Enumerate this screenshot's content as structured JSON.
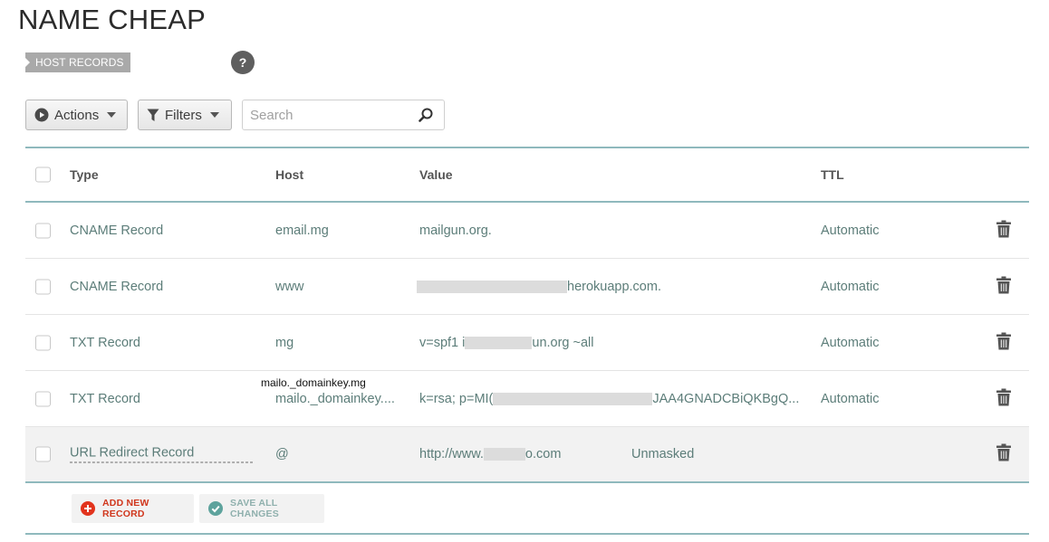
{
  "page_title": "NAME CHEAP",
  "section": {
    "label": "HOST RECORDS",
    "help": "?"
  },
  "toolbar": {
    "actions_label": "Actions",
    "filters_label": "Filters",
    "search_placeholder": "Search",
    "search_value": ""
  },
  "table": {
    "headers": {
      "type": "Type",
      "host": "Host",
      "value": "Value",
      "ttl": "TTL"
    },
    "rows": [
      {
        "type": "CNAME Record",
        "host": "email.mg",
        "value": "mailgun.org.",
        "ttl": "Automatic"
      },
      {
        "type": "CNAME Record",
        "host": "www",
        "value": "herokuapp.com.",
        "ttl": "Automatic"
      },
      {
        "type": "TXT Record",
        "host": "mg",
        "value_prefix": "v=spf1 i",
        "value_mid": "un.org ~all",
        "ttl": "Automatic"
      },
      {
        "type": "TXT Record",
        "host": "mailo._domainkey....",
        "value_prefix": "k=rsa; p=MI(",
        "value_suffix": "JAA4GNADCBiQKBgQ...",
        "ttl": "Automatic"
      },
      {
        "type": "URL Redirect Record",
        "host": "@",
        "value_prefix": "http://www.",
        "value_suffix": "o.com",
        "extra": "Unmasked"
      }
    ]
  },
  "tooltip": "mailo._domainkey.mg",
  "bottom": {
    "add_label": "ADD NEW RECORD",
    "save_label": "SAVE ALL CHANGES"
  },
  "colors": {
    "accent_teal": "#8fb9bd",
    "add_red": "#d0361c",
    "save_teal": "#5ea39d",
    "text_teal": "#5c7d79"
  }
}
